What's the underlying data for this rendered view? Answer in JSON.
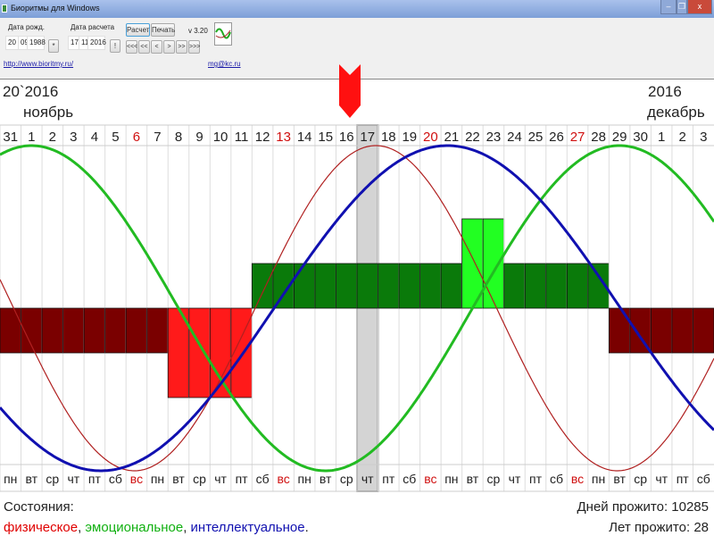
{
  "window": {
    "title": "Биоритмы для Windows",
    "minimize": "–",
    "restore": "❐",
    "close": "x"
  },
  "controls": {
    "birth_label": "Дата рожд.",
    "birth_day": "20",
    "birth_month": "09",
    "birth_year": "1988",
    "birth_btn": "*",
    "calc_label": "Дата расчета",
    "calc_day": "17",
    "calc_month": "11",
    "calc_year": "2016",
    "calc_btn": "!",
    "calc_button": "Расчет",
    "print_button": "Печать",
    "version": "v 3.20",
    "nav": [
      "<<<",
      "<<",
      "<",
      ">",
      ">>",
      ">>>"
    ],
    "site_link": "http://www.bioritmy.ru/",
    "email_link": "mg@kc.ru"
  },
  "chart_header": {
    "left_year": "20`2016",
    "left_month": "ноябрь",
    "right_year": "2016",
    "right_month": "декабрь"
  },
  "chart_data": {
    "type": "line",
    "days": [
      "31",
      "1",
      "2",
      "3",
      "4",
      "5",
      "6",
      "7",
      "8",
      "9",
      "10",
      "11",
      "12",
      "13",
      "14",
      "15",
      "16",
      "17",
      "18",
      "19",
      "20",
      "21",
      "22",
      "23",
      "24",
      "25",
      "26",
      "27",
      "28",
      "29",
      "30",
      "1",
      "2",
      "3"
    ],
    "weekdays": [
      "пн",
      "вт",
      "ср",
      "чт",
      "пт",
      "сб",
      "вс",
      "пн",
      "вт",
      "ср",
      "чт",
      "пт",
      "сб",
      "вс",
      "пн",
      "вт",
      "ср",
      "чт",
      "пт",
      "сб",
      "вс",
      "пн",
      "вт",
      "ср",
      "чт",
      "пт",
      "сб",
      "вс",
      "пн",
      "вт",
      "ср",
      "чт",
      "пт",
      "сб"
    ],
    "sundays": [
      6,
      13,
      20,
      27
    ],
    "selected_index": 17,
    "series": [
      {
        "name": "физическое",
        "color": "#b02020",
        "period": 23,
        "peak_day_index": 17.4
      },
      {
        "name": "эмоциональное",
        "color": "#22bb22",
        "period": 28,
        "peak_day_index": 1.0
      },
      {
        "name": "интеллектуальное",
        "color": "#1010b0",
        "period": 33,
        "peak_day_index": 20.8
      }
    ],
    "bar_states": [
      -1,
      -1,
      -1,
      -1,
      -1,
      -1,
      -1,
      -1,
      -2,
      -2,
      -2,
      -2,
      1,
      1,
      1,
      1,
      1,
      1,
      1,
      1,
      1,
      1,
      2,
      2,
      1,
      1,
      1,
      1,
      1,
      -1,
      -1,
      -1,
      -1,
      -1
    ],
    "bar_colors": {
      "-2": "#ff1a1a",
      "-1": "#7a0000",
      "1": "#0a7a0a",
      "2": "#22ff22"
    }
  },
  "status": {
    "label": "Состояния:",
    "physical": "физическое",
    "emotional": "эмоциональное",
    "intellectual": "интеллектуальное",
    "sep1": ", ",
    "sep2": ", ",
    "end": ".",
    "days_lived": "Дней прожито: 10285",
    "years_lived": "Лет прожито: 28"
  }
}
